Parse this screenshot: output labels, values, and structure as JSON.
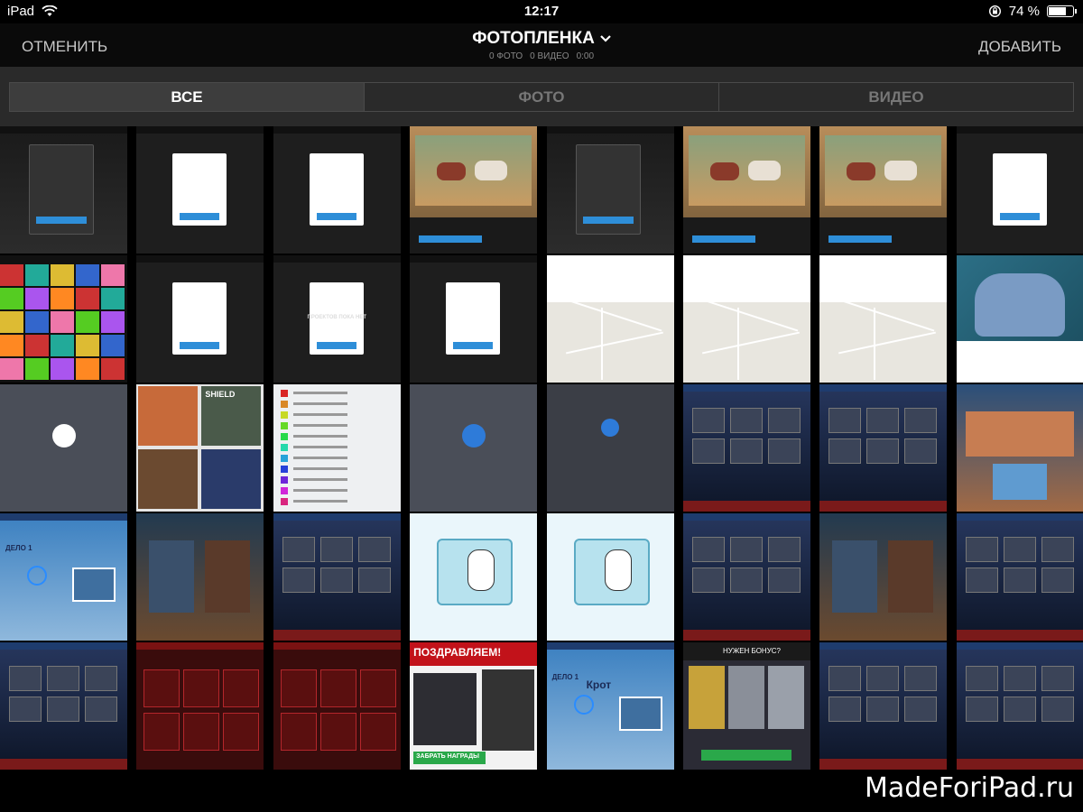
{
  "status": {
    "device": "iPad",
    "time": "12:17",
    "battery": "74 %",
    "battery_level": 0.74
  },
  "nav": {
    "cancel": "ОТМЕНИТЬ",
    "title": "ФОТОПЛЕНКА",
    "add": "ДОБАВИТЬ",
    "counts": {
      "photos": "0 ФОТО",
      "videos": "0 ВИДЕО",
      "duration": "0:00"
    }
  },
  "tabs": {
    "all": "ВСЕ",
    "photo": "ФОТО",
    "video": "ВИДЕО",
    "selected": "all"
  },
  "thumbnails": [
    {
      "type": "dark"
    },
    {
      "type": "app"
    },
    {
      "type": "app"
    },
    {
      "type": "cow"
    },
    {
      "type": "dark"
    },
    {
      "type": "cow"
    },
    {
      "type": "cow"
    },
    {
      "type": "app"
    },
    {
      "type": "collage"
    },
    {
      "type": "app"
    },
    {
      "type": "app"
    },
    {
      "type": "app"
    },
    {
      "type": "map"
    },
    {
      "type": "map"
    },
    {
      "type": "map"
    },
    {
      "type": "fabric"
    },
    {
      "type": "slate"
    },
    {
      "type": "photos"
    },
    {
      "type": "light"
    },
    {
      "type": "slate"
    },
    {
      "type": "grey"
    },
    {
      "type": "game"
    },
    {
      "type": "game"
    },
    {
      "type": "shelves"
    },
    {
      "type": "blueroom"
    },
    {
      "type": "office"
    },
    {
      "type": "game"
    },
    {
      "type": "cartoon"
    },
    {
      "type": "cartoon"
    },
    {
      "type": "game"
    },
    {
      "type": "office"
    },
    {
      "type": "game"
    },
    {
      "type": "game"
    },
    {
      "type": "shop"
    },
    {
      "type": "shop"
    },
    {
      "type": "promo"
    },
    {
      "type": "blueroom"
    },
    {
      "type": "bonus"
    },
    {
      "type": "game"
    },
    {
      "type": "game"
    }
  ],
  "thumb_text": {
    "no_projects": "ПРОЕКТОВ ПОКА НЕТ",
    "congrats": "ПОЗДРАВЛЯЕМ!",
    "collect": "ЗАБРАТЬ НАГРАДЫ",
    "mole": "Крот",
    "case": "ДЕЛО 1",
    "shield": "SHIELD",
    "bonus": "НУЖЕН БОНУС?"
  },
  "watermark": "MadeForiPad.ru",
  "colors": {
    "background": "#000000",
    "nav": "#0a0a0a",
    "tabs_bg": "#2a2a2a",
    "active_tab": "#3d3d3d",
    "inactive_tab_text": "#777777"
  }
}
